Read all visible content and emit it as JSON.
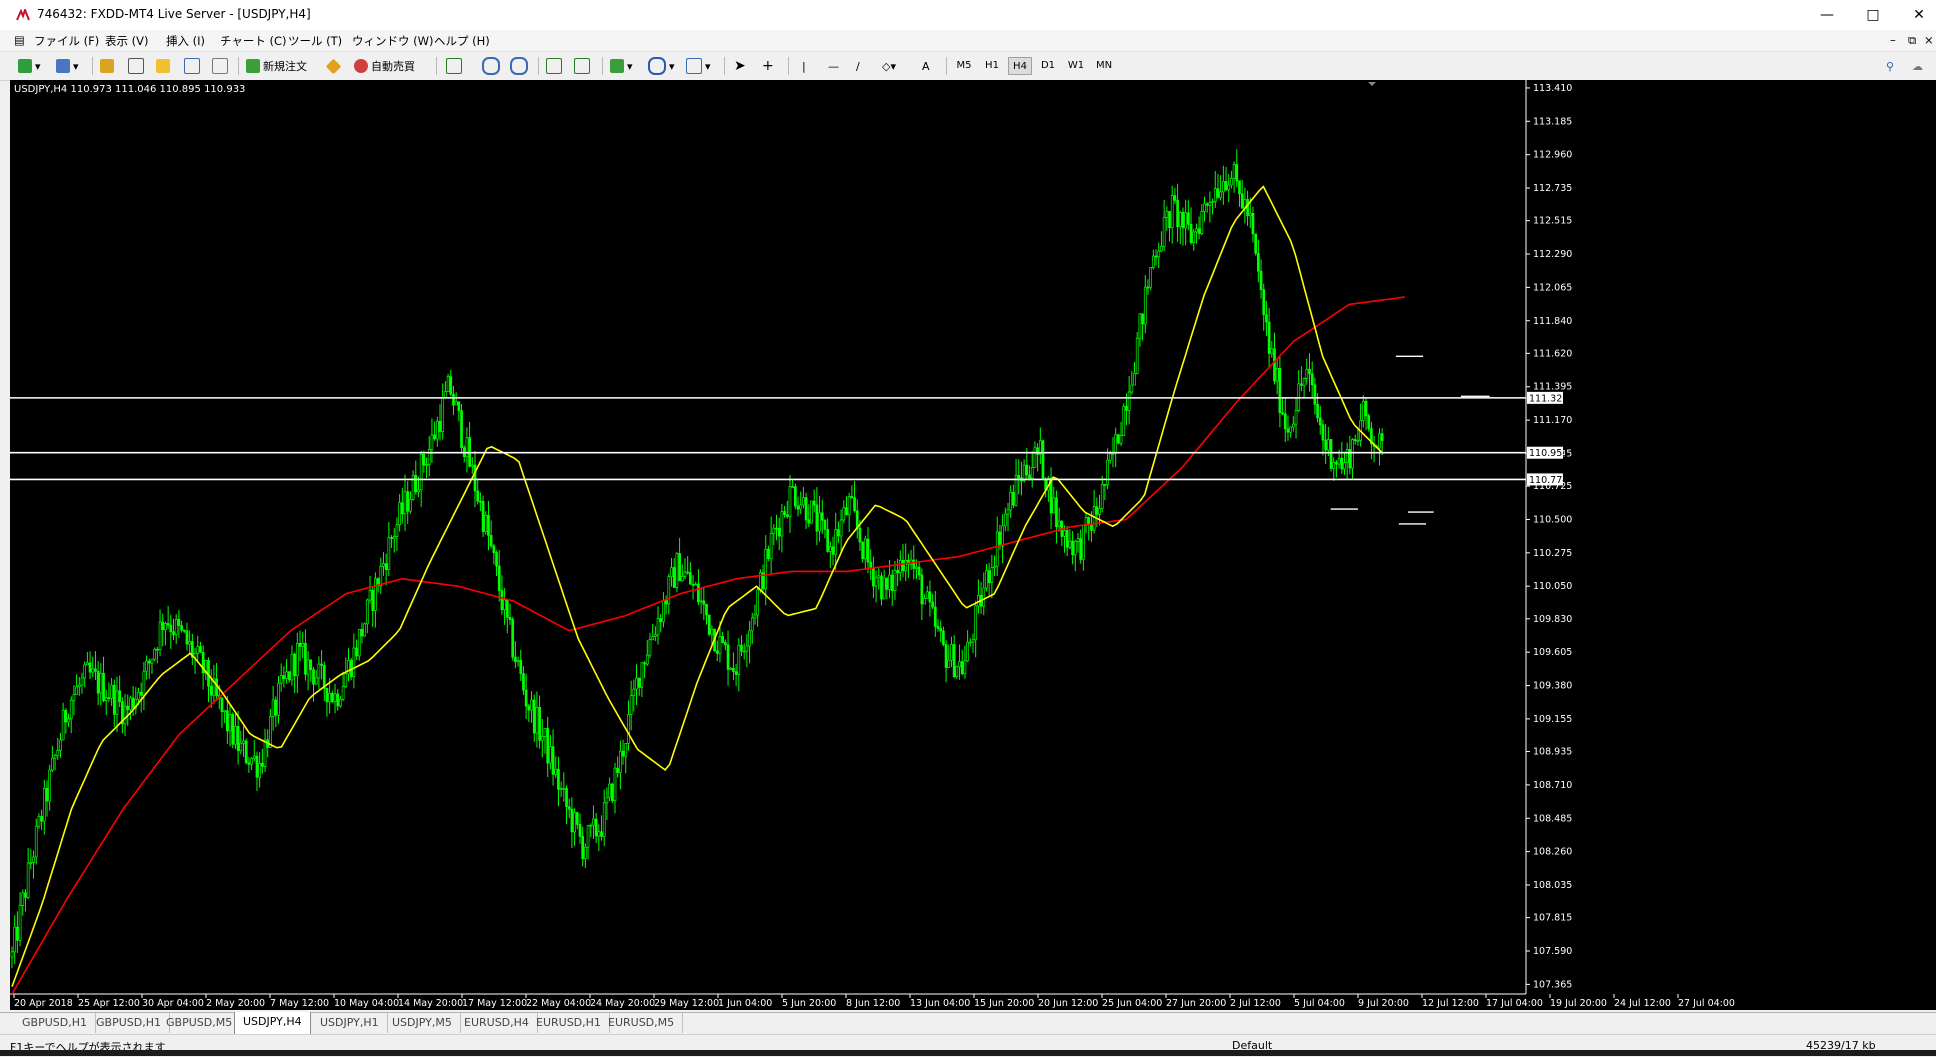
{
  "window": {
    "title": "746432: FXDD-MT4 Live Server - [USDJPY,H4]"
  },
  "menu": [
    "ファイル (F)",
    "表示 (V)",
    "挿入 (I)",
    "チャート (C)",
    "ツール (T)",
    "ウィンドウ (W)",
    "ヘルプ (H)"
  ],
  "toolbar": {
    "new_order": "新規注文",
    "auto_trade": "自動売買",
    "text_tool": "A"
  },
  "timeframes": [
    "M5",
    "H1",
    "H4",
    "D1",
    "W1",
    "MN"
  ],
  "active_timeframe": "H4",
  "chart_data": {
    "type": "candlestick",
    "symbol_info": "USDJPY,H4  110.973 111.046 110.895 110.933",
    "ylim": [
      107.3,
      113.45
    ],
    "y_ticks": [
      "113.410",
      "113.185",
      "112.960",
      "112.735",
      "112.515",
      "112.290",
      "112.065",
      "111.840",
      "111.620",
      "111.395",
      "111.170",
      "110.945",
      "110.725",
      "110.500",
      "110.275",
      "110.050",
      "109.830",
      "109.605",
      "109.380",
      "109.155",
      "108.935",
      "108.710",
      "108.485",
      "108.260",
      "108.035",
      "107.815",
      "107.590",
      "107.365"
    ],
    "x_labels": [
      "20 Apr 2018",
      "25 Apr 12:00",
      "30 Apr 04:00",
      "2 May 20:00",
      "7 May 12:00",
      "10 May 04:00",
      "14 May 20:00",
      "17 May 12:00",
      "22 May 04:00",
      "24 May 20:00",
      "29 May 12:00",
      "1 Jun 04:00",
      "5 Jun 20:00",
      "8 Jun 12:00",
      "13 Jun 04:00",
      "15 Jun 20:00",
      "20 Jun 12:00",
      "25 Jun 04:00",
      "27 Jun 20:00",
      "2 Jul 12:00",
      "5 Jul 04:00",
      "9 Jul 20:00",
      "12 Jul 12:00",
      "17 Jul 04:00",
      "19 Jul 20:00",
      "24 Jul 12:00",
      "27 Jul 04:00"
    ],
    "price_path": [
      107.55,
      108.2,
      108.75,
      109.28,
      109.45,
      109.35,
      109.2,
      109.45,
      109.85,
      109.7,
      109.5,
      109.2,
      108.95,
      108.85,
      109.3,
      109.6,
      109.45,
      109.3,
      109.6,
      110.0,
      110.4,
      110.7,
      111.0,
      111.4,
      110.9,
      110.4,
      109.8,
      109.3,
      109.0,
      108.6,
      108.3,
      108.45,
      108.9,
      109.5,
      109.85,
      110.2,
      110.0,
      109.7,
      109.5,
      109.9,
      110.4,
      110.7,
      110.55,
      110.3,
      110.6,
      110.2,
      110.0,
      110.3,
      109.95,
      109.6,
      109.5,
      110.0,
      110.45,
      110.8,
      110.95,
      110.45,
      110.3,
      110.55,
      111.0,
      111.6,
      112.3,
      112.6,
      112.4,
      112.7,
      112.85,
      112.55,
      111.7,
      111.1,
      111.5,
      111.0,
      110.85,
      111.2,
      110.95
    ],
    "ma_short": [
      107.35,
      107.9,
      108.55,
      109.0,
      109.2,
      109.45,
      109.6,
      109.35,
      109.05,
      108.95,
      109.3,
      109.45,
      109.55,
      109.75,
      110.2,
      110.6,
      111.0,
      110.9,
      110.3,
      109.7,
      109.3,
      108.95,
      108.8,
      109.4,
      109.9,
      110.05,
      109.85,
      109.9,
      110.35,
      110.6,
      110.5,
      110.2,
      109.9,
      110.0,
      110.45,
      110.8,
      110.55,
      110.45,
      110.65,
      111.35,
      112.0,
      112.5,
      112.75,
      112.35,
      111.6,
      111.15,
      110.95
    ],
    "ma_long": [
      107.3,
      107.95,
      108.55,
      109.05,
      109.4,
      109.75,
      110.0,
      110.1,
      110.05,
      109.95,
      109.75,
      109.85,
      110.0,
      110.1,
      110.15,
      110.15,
      110.2,
      110.25,
      110.35,
      110.45,
      110.5,
      110.85,
      111.3,
      111.7,
      111.95,
      112.0
    ],
    "horizontal_lines": [
      111.32,
      110.95,
      110.77
    ],
    "marked_price_labels": [
      "111.320",
      "110.951",
      "110.774"
    ],
    "short_segments": [
      {
        "t0": 0.914,
        "t1": 0.932,
        "y": 111.6
      },
      {
        "t0": 0.871,
        "t1": 0.889,
        "y": 110.57
      },
      {
        "t0": 0.922,
        "t1": 0.939,
        "y": 110.55
      },
      {
        "t0": 0.957,
        "t1": 0.976,
        "y": 111.33
      },
      {
        "t0": 0.916,
        "t1": 0.934,
        "y": 110.47
      }
    ],
    "colors": {
      "background": "#000000",
      "candle": "#00ff00",
      "ma_short": "#ffff00",
      "ma_long": "#ff0000",
      "hline": "#ffffff",
      "axis": "#ffffff"
    },
    "grid": false,
    "xlabel": "",
    "ylabel": ""
  },
  "tabs": [
    "GBPUSD,H1",
    "GBPUSD,H1",
    "GBPUSD,M5",
    "USDJPY,H4",
    "USDJPY,H1",
    "USDJPY,M5",
    "EURUSD,H4",
    "EURUSD,H1",
    "EURUSD,M5"
  ],
  "active_tab_index": 3,
  "status": {
    "help": "F1キーでヘルプが表示されます",
    "profile": "Default",
    "traffic": "45239/17 kb"
  }
}
